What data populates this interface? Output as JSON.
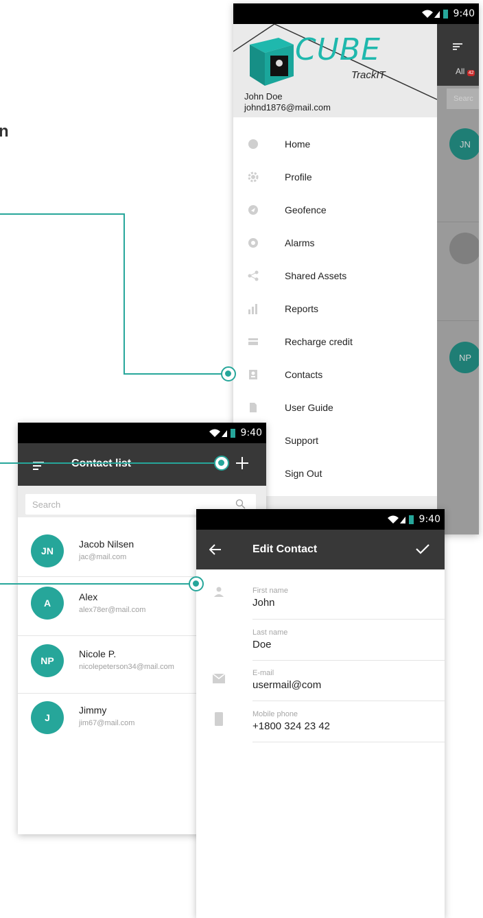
{
  "partial_heading": "n",
  "status": {
    "time": "9:40"
  },
  "drawer": {
    "logo_text": "CUBE",
    "logo_sub": "TrackIT",
    "user_name": "John Doe",
    "user_email": "johnd1876@mail.com",
    "items": [
      {
        "label": "Home",
        "icon": "home-icon"
      },
      {
        "label": "Profile",
        "icon": "gear-icon"
      },
      {
        "label": "Geofence",
        "icon": "navigation-icon"
      },
      {
        "label": "Alarms",
        "icon": "alarm-icon"
      },
      {
        "label": "Shared Assets",
        "icon": "share-icon"
      },
      {
        "label": "Reports",
        "icon": "bar-chart-icon"
      },
      {
        "label": "Recharge credit",
        "icon": "credit-card-icon"
      },
      {
        "label": "Contacts",
        "icon": "contact-card-icon"
      },
      {
        "label": "User Guide",
        "icon": "document-icon"
      },
      {
        "label": "Support",
        "icon": "support-icon"
      },
      {
        "label": "Sign Out",
        "icon": "sign-out-icon"
      }
    ],
    "behind": {
      "tab_all": "All",
      "tab_badge": "42",
      "search_placeholder": "Searc",
      "avatar_jn": "JN",
      "avatar_np": "NP"
    }
  },
  "contact_list": {
    "title": "Contact list",
    "search_placeholder": "Search",
    "contacts": [
      {
        "initials": "JN",
        "name": "Jacob Nilsen",
        "email": "jac@mail.com"
      },
      {
        "initials": "A",
        "name": "Alex",
        "email": "alex78er@mail.com"
      },
      {
        "initials": "NP",
        "name": "Nicole P.",
        "email": "nicolepeterson34@mail.com"
      },
      {
        "initials": "J",
        "name": "Jimmy",
        "email": "jim67@mail.com"
      }
    ]
  },
  "edit_contact": {
    "title": "Edit Contact",
    "fields": [
      {
        "label": "First name",
        "value": "John"
      },
      {
        "label": "Last name",
        "value": "Doe"
      },
      {
        "label": "E-mail",
        "value": "usermail@com"
      },
      {
        "label": "Mobile phone",
        "value": "+1800 324 23 42"
      }
    ]
  },
  "colors": {
    "accent": "#26a69a",
    "appbar": "#383838",
    "statusbar": "#000000"
  }
}
